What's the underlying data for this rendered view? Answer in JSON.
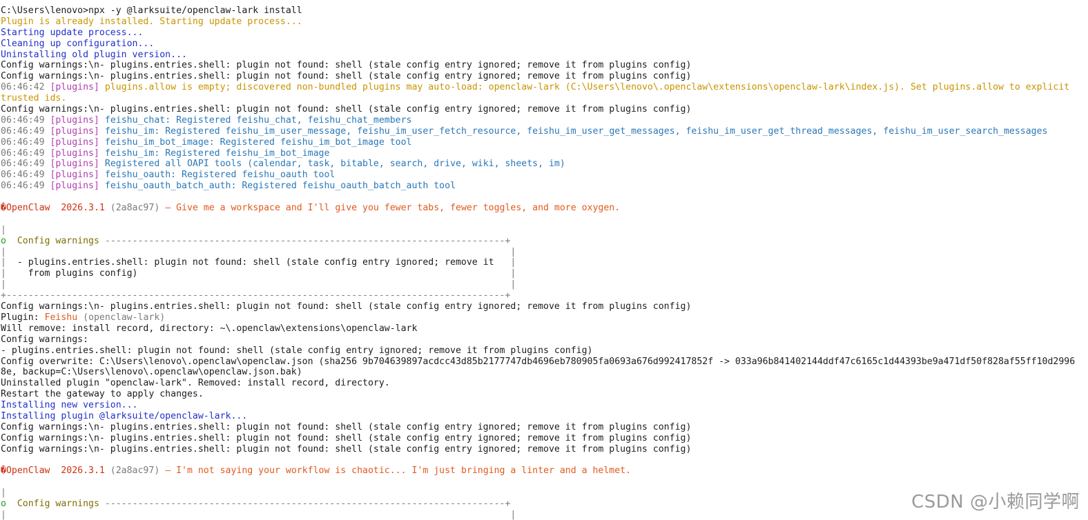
{
  "terminal": {
    "lines": [
      [
        {
          "t": "C:\\Users\\lenovo>npx -y @larksuite/openclaw-lark install",
          "c": "default"
        }
      ],
      [
        {
          "t": "Plugin is already installed. Starting update process...",
          "c": "yellow"
        }
      ],
      [
        {
          "t": "Starting update process...",
          "c": "blue"
        }
      ],
      [
        {
          "t": "Cleaning up configuration...",
          "c": "blue"
        }
      ],
      [
        {
          "t": "Uninstalling old plugin version...",
          "c": "blue"
        }
      ],
      [
        {
          "t": "Config warnings:\\n- plugins.entries.shell: plugin not found: shell (stale config entry ignored; remove it from plugins config)",
          "c": "default"
        }
      ],
      [
        {
          "t": "Config warnings:\\n- plugins.entries.shell: plugin not found: shell (stale config entry ignored; remove it from plugins config)",
          "c": "default"
        }
      ],
      [
        {
          "t": "06:46:42 ",
          "c": "gray"
        },
        {
          "t": "[plugins] ",
          "c": "magenta"
        },
        {
          "t": "plugins.allow is empty; discovered non-bundled plugins may auto-load: openclaw-lark (C:\\Users\\lenovo\\.openclaw\\extensions\\openclaw-lark\\index.js). Set plugins.allow to explicit",
          "c": "yellow"
        }
      ],
      [
        {
          "t": "trusted ids.",
          "c": "yellow"
        }
      ],
      [
        {
          "t": "Config warnings:\\n- plugins.entries.shell: plugin not found: shell (stale config entry ignored; remove it from plugins config)",
          "c": "default"
        }
      ],
      [
        {
          "t": "06:46:49 ",
          "c": "gray"
        },
        {
          "t": "[plugins] ",
          "c": "magenta"
        },
        {
          "t": "feishu_chat: Registered feishu_chat, feishu_chat_members",
          "c": "cyan"
        }
      ],
      [
        {
          "t": "06:46:49 ",
          "c": "gray"
        },
        {
          "t": "[plugins] ",
          "c": "magenta"
        },
        {
          "t": "feishu_im: Registered feishu_im_user_message, feishu_im_user_fetch_resource, feishu_im_user_get_messages, feishu_im_user_get_thread_messages, feishu_im_user_search_messages",
          "c": "cyan"
        }
      ],
      [
        {
          "t": "06:46:49 ",
          "c": "gray"
        },
        {
          "t": "[plugins] ",
          "c": "magenta"
        },
        {
          "t": "feishu_im_bot_image: Registered feishu_im_bot_image tool",
          "c": "cyan"
        }
      ],
      [
        {
          "t": "06:46:49 ",
          "c": "gray"
        },
        {
          "t": "[plugins] ",
          "c": "magenta"
        },
        {
          "t": "feishu_im: Registered feishu_im_bot_image",
          "c": "cyan"
        }
      ],
      [
        {
          "t": "06:46:49 ",
          "c": "gray"
        },
        {
          "t": "[plugins] ",
          "c": "magenta"
        },
        {
          "t": "Registered all OAPI tools (calendar, task, bitable, search, drive, wiki, sheets, im)",
          "c": "cyan"
        }
      ],
      [
        {
          "t": "06:46:49 ",
          "c": "gray"
        },
        {
          "t": "[plugins] ",
          "c": "magenta"
        },
        {
          "t": "feishu_oauth: Registered feishu_oauth tool",
          "c": "cyan"
        }
      ],
      [
        {
          "t": "06:46:49 ",
          "c": "gray"
        },
        {
          "t": "[plugins] ",
          "c": "magenta"
        },
        {
          "t": "feishu_oauth_batch_auth: Registered feishu_oauth_batch_auth tool",
          "c": "cyan"
        }
      ],
      [
        {
          "t": " ",
          "c": "default"
        }
      ],
      [
        {
          "t": "�OpenClaw  2026.3.1 ",
          "c": "red"
        },
        {
          "t": "(2a8ac97)",
          "c": "gray"
        },
        {
          "t": " — Give me a workspace and I'll give you fewer tabs, fewer toggles, and more oxygen.",
          "c": "orange"
        }
      ],
      [
        {
          "t": " ",
          "c": "default"
        }
      ],
      [
        {
          "t": "|",
          "c": "gray"
        }
      ],
      [
        {
          "t": "o  ",
          "c": "green"
        },
        {
          "t": "Config warnings ",
          "c": "olive"
        },
        {
          "t": "-------------------------------------------------------------------------+",
          "c": "gray"
        }
      ],
      [
        {
          "t": "|                                                                                            |",
          "c": "gray"
        }
      ],
      [
        {
          "t": "|  ",
          "c": "gray"
        },
        {
          "t": "- plugins.entries.shell: plugin not found: shell (stale config entry ignored; remove it   ",
          "c": "default"
        },
        {
          "t": "|",
          "c": "gray"
        }
      ],
      [
        {
          "t": "|    ",
          "c": "gray"
        },
        {
          "t": "from plugins config)                                                                    ",
          "c": "default"
        },
        {
          "t": "|",
          "c": "gray"
        }
      ],
      [
        {
          "t": "|                                                                                            |",
          "c": "gray"
        }
      ],
      [
        {
          "t": "+-------------------------------------------------------------------------------------------+",
          "c": "gray"
        }
      ],
      [
        {
          "t": "Config warnings:\\n- plugins.entries.shell: plugin not found: shell (stale config entry ignored; remove it from plugins config)",
          "c": "default"
        }
      ],
      [
        {
          "t": "Plugin: ",
          "c": "default"
        },
        {
          "t": "Feishu",
          "c": "orange"
        },
        {
          "t": " (openclaw-lark)",
          "c": "gray"
        }
      ],
      [
        {
          "t": "Will remove: install record, directory: ~\\.openclaw\\extensions\\openclaw-lark",
          "c": "default"
        }
      ],
      [
        {
          "t": "Config warnings:",
          "c": "default"
        }
      ],
      [
        {
          "t": "- plugins.entries.shell: plugin not found: shell (stale config entry ignored; remove it from plugins config)",
          "c": "default"
        }
      ],
      [
        {
          "t": "Config overwrite: C:\\Users\\lenovo\\.openclaw\\openclaw.json (sha256 9b704639897acdcc43d85b2177747db4696eb780905fa0693a676d992417852f -> 033a96b841402144ddf47c6165c1d44393be9a471df50f828af55ff10d2996",
          "c": "default"
        }
      ],
      [
        {
          "t": "8e, backup=C:\\Users\\lenovo\\.openclaw\\openclaw.json.bak)",
          "c": "default"
        }
      ],
      [
        {
          "t": "Uninstalled plugin \"openclaw-lark\". Removed: install record, directory.",
          "c": "default"
        }
      ],
      [
        {
          "t": "Restart the gateway to apply changes.",
          "c": "default"
        }
      ],
      [
        {
          "t": "Installing new version...",
          "c": "blue"
        }
      ],
      [
        {
          "t": "Installing plugin @larksuite/openclaw-lark...",
          "c": "blue"
        }
      ],
      [
        {
          "t": "Config warnings:\\n- plugins.entries.shell: plugin not found: shell (stale config entry ignored; remove it from plugins config)",
          "c": "default"
        }
      ],
      [
        {
          "t": "Config warnings:\\n- plugins.entries.shell: plugin not found: shell (stale config entry ignored; remove it from plugins config)",
          "c": "default"
        }
      ],
      [
        {
          "t": "Config warnings:\\n- plugins.entries.shell: plugin not found: shell (stale config entry ignored; remove it from plugins config)",
          "c": "default"
        }
      ],
      [
        {
          "t": " ",
          "c": "default"
        }
      ],
      [
        {
          "t": "�OpenClaw  2026.3.1 ",
          "c": "red"
        },
        {
          "t": "(2a8ac97)",
          "c": "gray"
        },
        {
          "t": " — I'm not saying your workflow is chaotic... I'm just bringing a linter and a helmet.",
          "c": "orange"
        }
      ],
      [
        {
          "t": " ",
          "c": "default"
        }
      ],
      [
        {
          "t": "|",
          "c": "gray"
        }
      ],
      [
        {
          "t": "o  ",
          "c": "green"
        },
        {
          "t": "Config warnings ",
          "c": "olive"
        },
        {
          "t": "-------------------------------------------------------------------------+",
          "c": "gray"
        }
      ],
      [
        {
          "t": "|                                                                                            |",
          "c": "gray"
        }
      ]
    ]
  },
  "watermark": {
    "text": "CSDN @小赖同学啊"
  }
}
